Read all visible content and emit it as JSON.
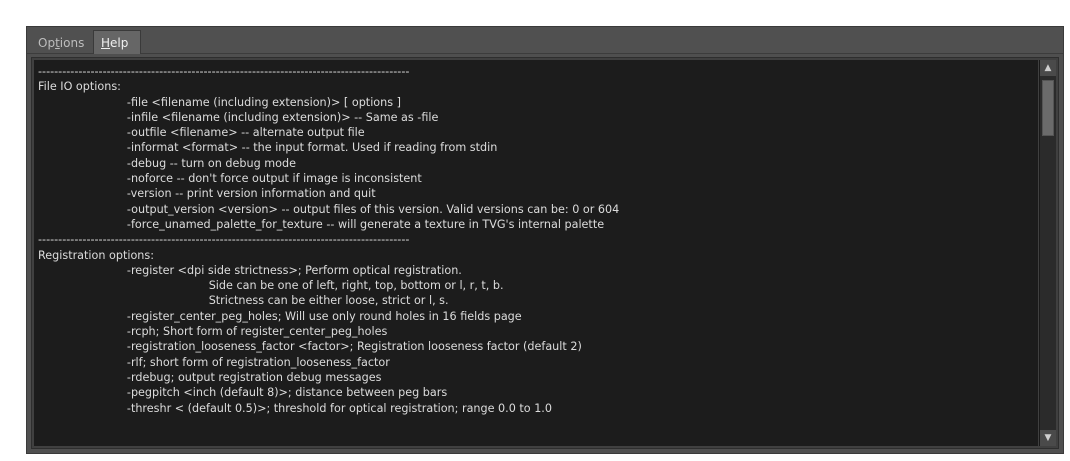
{
  "tabs": [
    {
      "label_pre": "Op",
      "label_ul": "t",
      "label_post": "ions",
      "active": false
    },
    {
      "label_pre": "",
      "label_ul": "H",
      "label_post": "elp",
      "active": true
    }
  ],
  "help_lines": [
    "--------------------------------------------------------------------------------------------",
    "File IO options:",
    "                         -file <filename (including extension)> [ options ]",
    "                         -infile <filename (including extension)> -- Same as -file",
    "                         -outfile <filename> -- alternate output file",
    "                         -informat <format> -- the input format. Used if reading from stdin",
    "                         -debug -- turn on debug mode",
    "                         -noforce -- don't force output if image is inconsistent",
    "                         -version -- print version information and quit",
    "                         -output_version <version> -- output files of this version. Valid versions can be: 0 or 604",
    "                         -force_unamed_palette_for_texture -- will generate a texture in TVG's internal palette",
    "--------------------------------------------------------------------------------------------",
    "Registration options:",
    "                         -register <dpi side strictness>; Perform optical registration.",
    "                                                Side can be one of left, right, top, bottom or l, r, t, b.",
    "                                                Strictness can be either loose, strict or l, s.",
    "                         -register_center_peg_holes; Will use only round holes in 16 fields page",
    "                         -rcph; Short form of register_center_peg_holes",
    "                         -registration_looseness_factor <factor>; Registration looseness factor (default 2)",
    "                         -rlf; short form of registration_looseness_factor",
    "                         -rdebug; output registration debug messages",
    "                         -pegpitch <inch (default 8)>; distance between peg bars",
    "                         -threshr < (default 0.5)>; threshold for optical registration; range 0.0 to 1.0"
  ],
  "scrollbar": {
    "up_icon": "triangle-up",
    "down_icon": "triangle-down",
    "position": 0.0
  }
}
